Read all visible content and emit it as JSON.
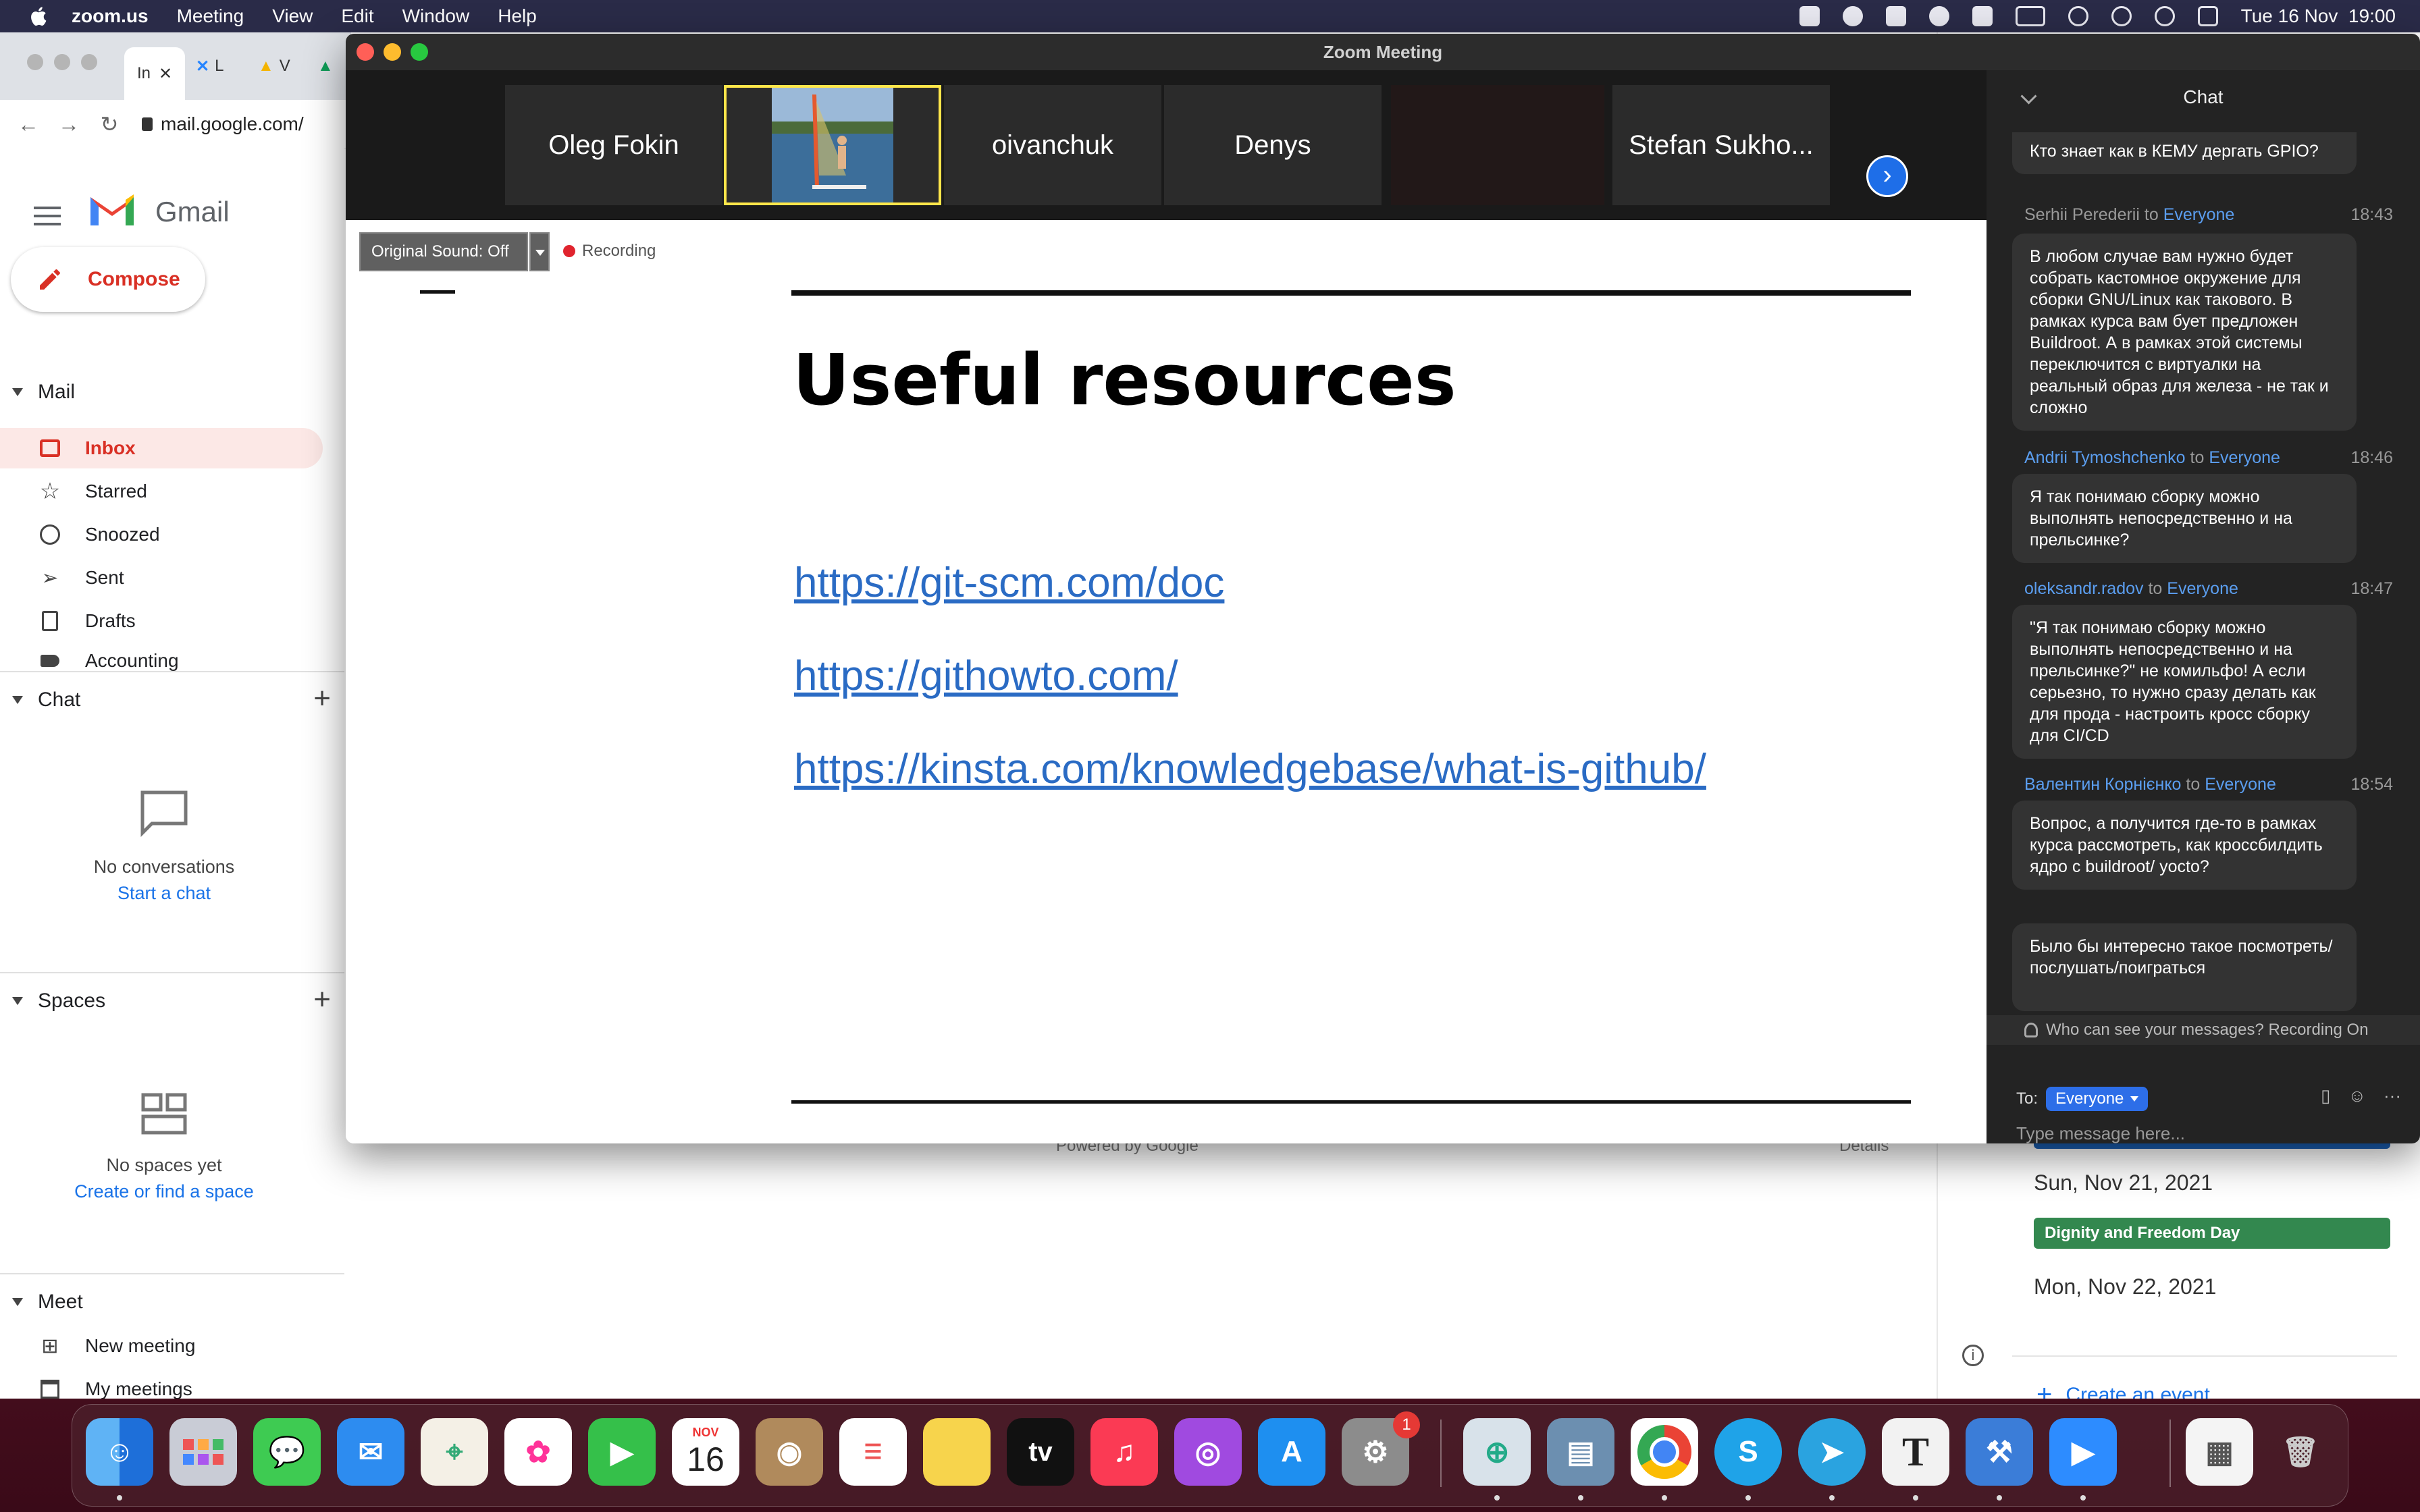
{
  "menubar": {
    "app_name": "zoom.us",
    "menus": [
      "Meeting",
      "View",
      "Edit",
      "Window",
      "Help"
    ],
    "clock": "Tue 16 Nov  19:00"
  },
  "browser": {
    "active_tab_label": "In",
    "tab2_label": "L",
    "tab3_label": "V",
    "url": "mail.google.com/"
  },
  "gmail": {
    "title": "Gmail",
    "compose": "Compose",
    "mail_section": "Mail",
    "nav": [
      {
        "label": "Inbox"
      },
      {
        "label": "Starred"
      },
      {
        "label": "Snoozed"
      },
      {
        "label": "Sent"
      },
      {
        "label": "Drafts"
      },
      {
        "label": "Accounting"
      }
    ],
    "chat_section": "Chat",
    "chat_empty": "No conversations",
    "chat_link": "Start a chat",
    "spaces_section": "Spaces",
    "spaces_empty": "No spaces yet",
    "spaces_link": "Create or find a space",
    "meet_section": "Meet",
    "meet_items": [
      "New meeting",
      "My meetings"
    ],
    "powered_by": "Powered by Google",
    "details": "Details"
  },
  "calendar": {
    "date1": "Sun, Nov 21, 2021",
    "event1": "Dignity and Freedom Day",
    "date2": "Mon, Nov 22, 2021",
    "create": "Create an event",
    "event_color": "#33884f"
  },
  "zoom": {
    "window_title": "Zoom Meeting",
    "participants": [
      "Oleg Fokin",
      "",
      "oivanchuk",
      "Denys",
      "",
      "Stefan Sukho..."
    ],
    "original_sound": "Original Sound: Off",
    "recording": "Recording",
    "slide": {
      "title": "Useful resources",
      "links": [
        "https://git-scm.com/doc",
        "https://githowto.com/",
        "https://kinsta.com/knowledgebase/what-is-github/"
      ]
    },
    "chat": {
      "title": "Chat",
      "to_word": "to",
      "messages": [
        {
          "text": "Кто знает как в КЕМУ дергать GPIO?"
        },
        {
          "from": "Serhii Perederii",
          "to": "Everyone",
          "time": "18:43",
          "text": "В любом случае вам нужно будет собрать кастомное окружение для сборки GNU/Linux как такового. В рамках курса вам бует предложен Buildroot. А в рамках этой системы переключится с виртуалки на реальный образ для железа - не так и сложно"
        },
        {
          "from": "Andrii Tymoshchenko",
          "to": "Everyone",
          "time": "18:46",
          "text": "Я так понимаю сборку можно выполнять непосредственно и на прельсинке?"
        },
        {
          "from": "oleksandr.radov",
          "to": "Everyone",
          "time": "18:47",
          "text": "\"Я так понимаю сборку можно выполнять непосредственно и на прельсинке?\" не комильфо! А если серьезно, то нужно сразу делать как для прода - настроить кросс сборку для CI/CD"
        },
        {
          "from": "Валентин Корнієнко",
          "to": "Everyone",
          "time": "18:54",
          "text": "Вопрос, а получится где-то в рамках курса рассмотреть, как кроссбилдить ядро с buildroot/ yocto?"
        },
        {
          "text": "Было бы интересно такое посмотреть/послушать/поиграться"
        }
      ],
      "who_can_see": "Who can see your messages? Recording On",
      "to_label": "To:",
      "to_value": "Everyone",
      "input_placeholder": "Type message here..."
    }
  },
  "dock": {
    "calendar_month": "NOV",
    "calendar_day": "16",
    "settings_badge": "1",
    "tv_label": "tv"
  }
}
